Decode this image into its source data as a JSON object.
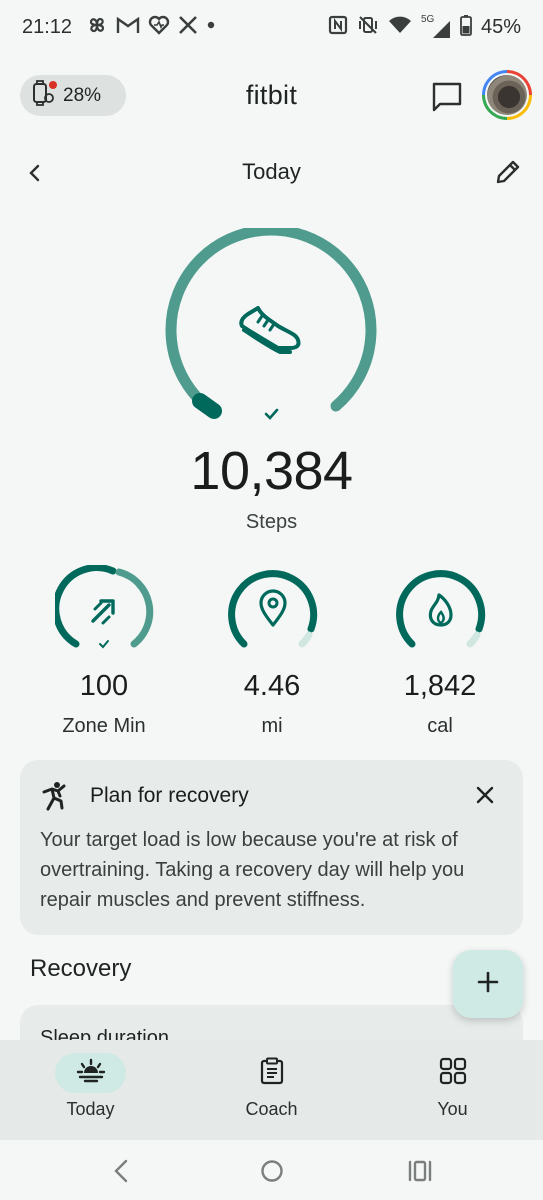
{
  "status_bar": {
    "time": "21:12",
    "notification_icons": [
      "pinwheel-icon",
      "gmail-icon",
      "fitbit-heart-icon",
      "x-icon",
      "dot-icon"
    ],
    "right_icons": [
      "nfc-icon",
      "vibrate-off-icon",
      "wifi-icon",
      "signal-5g-icon",
      "battery-icon"
    ],
    "network": "5G",
    "battery_percent": "45%"
  },
  "header": {
    "device_battery": "28%",
    "app_title": "fitbit",
    "icons": {
      "device": "watch-icon",
      "chat": "chat-icon",
      "avatar": "avatar"
    }
  },
  "date_bar": {
    "title": "Today",
    "back_icon": "chevron-left-icon",
    "edit_icon": "pencil-icon"
  },
  "steps": {
    "value": "10,384",
    "label": "Steps",
    "goal_progress": 1.0,
    "goal_met": true,
    "icon": "shoe-icon"
  },
  "stats": [
    {
      "value": "100",
      "label": "Zone Min",
      "icon": "zone-arrow-icon",
      "progress": 1.0,
      "goal_met": true
    },
    {
      "value": "4.46",
      "label": "mi",
      "icon": "location-pin-icon",
      "progress": 0.88,
      "goal_met": false
    },
    {
      "value": "1,842",
      "label": "cal",
      "icon": "flame-icon",
      "progress": 0.88,
      "goal_met": false
    }
  ],
  "recovery_card": {
    "icon": "running-figure-icon",
    "title": "Plan for recovery",
    "body": "Your target load is low because you're at risk of overtraining. Taking a recovery day will help you repair muscles and prevent stiffness.",
    "close_icon": "close-icon"
  },
  "sections": {
    "recovery_title": "Recovery",
    "peek_card_text": "Sleep duration"
  },
  "fab": {
    "icon": "plus-icon"
  },
  "bottom_nav": [
    {
      "label": "Today",
      "icon": "sunrise-icon",
      "active": true
    },
    {
      "label": "Coach",
      "icon": "clipboard-icon",
      "active": false
    },
    {
      "label": "You",
      "icon": "grid-icon",
      "active": false
    }
  ],
  "system_nav": [
    "back-icon",
    "home-icon",
    "recents-icon"
  ],
  "colors": {
    "accent": "#00695c",
    "ring_light": "#4f9c8f",
    "ring_track": "#cfe6e1",
    "background": "#f4f7f5",
    "card": "#e7ebe9"
  }
}
